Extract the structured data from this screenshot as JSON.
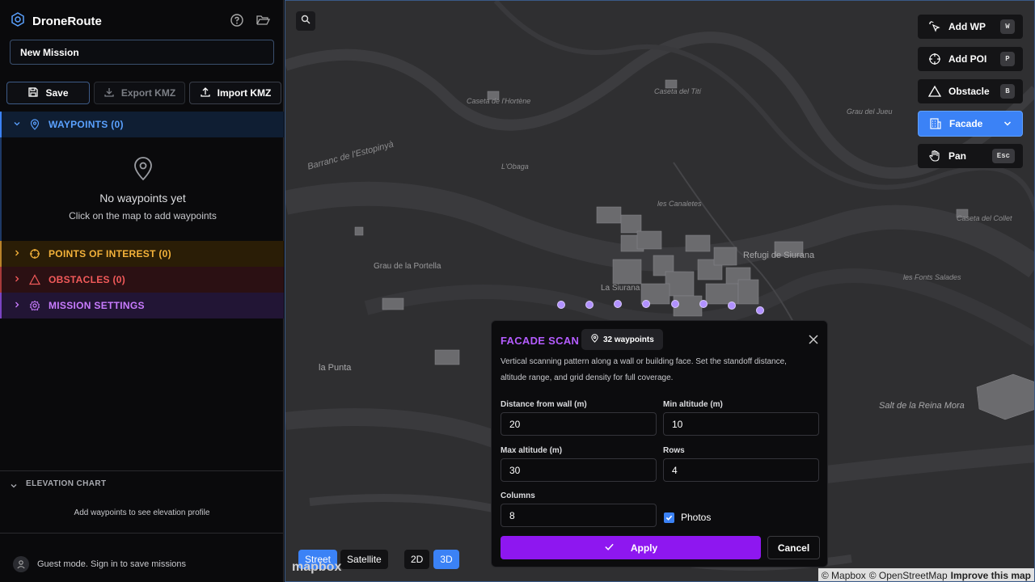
{
  "app": {
    "title": "DroneRoute"
  },
  "mission": {
    "name_value": "New Mission"
  },
  "toolbar": {
    "save": "Save",
    "export": "Export KMZ",
    "import": "Import KMZ"
  },
  "sections": {
    "waypoints": "WAYPOINTS (0)",
    "poi": "POINTS OF INTEREST (0)",
    "obstacles": "OBSTACLES (0)",
    "settings": "MISSION SETTINGS"
  },
  "waypoints_empty": {
    "title": "No waypoints yet",
    "subtitle": "Click on the map to add waypoints"
  },
  "elevation": {
    "title": "ELEVATION CHART",
    "message": "Add waypoints to see elevation profile"
  },
  "guest": {
    "text": "Guest mode. Sign in to save missions"
  },
  "map_labels": {
    "caseta_hortene": "Caseta de l'Hortène",
    "caseta_titi": "Caseta del Tití",
    "grau_jueu": "Grau del Jueu",
    "barranc": "Barranc de l'Estopinyà",
    "obaga": "L'Obaga",
    "canaletes": "les Canaletes",
    "caseta_collet": "Caseta del Collet",
    "grau_portella": "Grau de la Portella",
    "refugi": "Refugi de Siurana",
    "fonts": "les Fonts Salades",
    "siurana": "La Siurana",
    "punta": "la Punta",
    "salt": "Salt de la Reina Mora"
  },
  "tools": {
    "add_wp": {
      "label": "Add WP",
      "key": "W"
    },
    "add_poi": {
      "label": "Add POI",
      "key": "P"
    },
    "obstacle": {
      "label": "Obstacle",
      "key": "B"
    },
    "facade": {
      "label": "Facade"
    },
    "pan": {
      "label": "Pan",
      "key": "Esc"
    }
  },
  "map_controls": {
    "street": "Street",
    "satellite": "Satellite",
    "d2": "2D",
    "d3": "3D",
    "active_style": "Street",
    "active_dim": "3D"
  },
  "attribution": {
    "mapbox": "© Mapbox",
    "osm": "© OpenStreetMap",
    "improve": "Improve this map",
    "logo": "mapbox"
  },
  "facade_scan": {
    "title": "FACADE SCAN",
    "badge": "32 waypoints",
    "description": "Vertical scanning pattern along a wall or building face. Set the standoff distance, altitude range, and grid density for full coverage.",
    "distance_label": "Distance from wall (m)",
    "distance_value": "20",
    "min_alt_label": "Min altitude (m)",
    "min_alt_value": "10",
    "max_alt_label": "Max altitude (m)",
    "max_alt_value": "30",
    "rows_label": "Rows",
    "rows_value": "4",
    "columns_label": "Columns",
    "columns_value": "8",
    "photos_label": "Photos",
    "photos_checked": true,
    "apply": "Apply",
    "cancel": "Cancel"
  },
  "colors": {
    "accent_blue": "#3b82f6",
    "purple": "#8e17f0",
    "poi": "#f4b23a",
    "obstacle": "#f25a5a",
    "settings": "#c97cff"
  }
}
